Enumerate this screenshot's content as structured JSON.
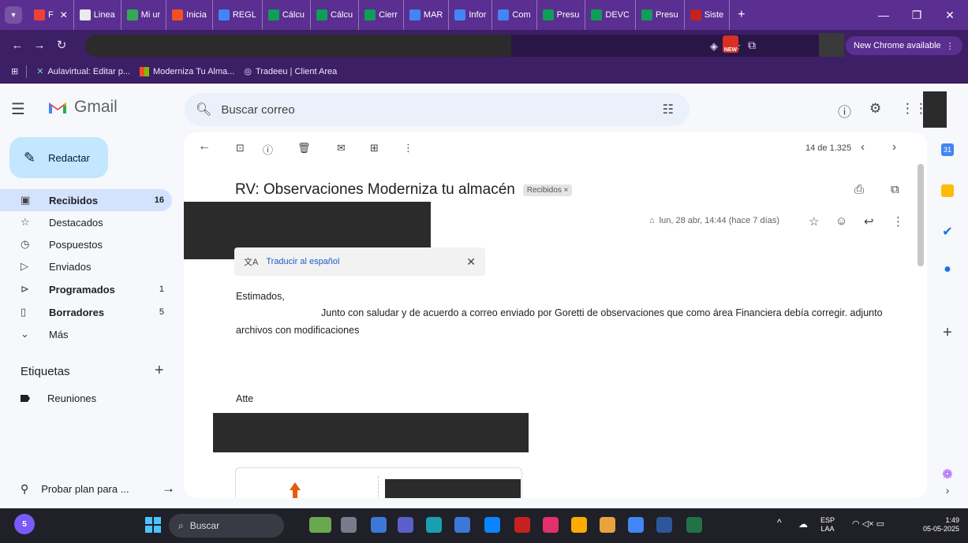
{
  "browser": {
    "tabs": [
      {
        "label": "F",
        "active": true
      },
      {
        "label": "Linea"
      },
      {
        "label": "Mi ur"
      },
      {
        "label": "Inicia"
      },
      {
        "label": "REGL"
      },
      {
        "label": "Cálcu"
      },
      {
        "label": "Cálcu"
      },
      {
        "label": "Cierr"
      },
      {
        "label": "MAR"
      },
      {
        "label": "Infor"
      },
      {
        "label": "Com"
      },
      {
        "label": "Presu"
      },
      {
        "label": "DEVC"
      },
      {
        "label": "Presu"
      },
      {
        "label": "Siste"
      }
    ],
    "update_label": "New Chrome available",
    "new_badge": "NEW",
    "bookmarks": [
      {
        "label": "Aulavirtual: Editar p..."
      },
      {
        "label": "Moderniza Tu Alma..."
      },
      {
        "label": "Tradeeu | Client Area"
      }
    ]
  },
  "gmail": {
    "logo_text": "Gmail",
    "search_placeholder": "Buscar correo",
    "compose_label": "Redactar",
    "nav": [
      {
        "label": "Recibidos",
        "count": "16",
        "icon": "inbox-icon",
        "active": true,
        "bold": true
      },
      {
        "label": "Destacados",
        "count": "",
        "icon": "star-icon"
      },
      {
        "label": "Pospuestos",
        "count": "",
        "icon": "clock-icon"
      },
      {
        "label": "Enviados",
        "count": "",
        "icon": "send-icon"
      },
      {
        "label": "Programados",
        "count": "1",
        "icon": "scheduled-icon",
        "bold": true
      },
      {
        "label": "Borradores",
        "count": "5",
        "icon": "draft-icon",
        "bold": true
      },
      {
        "label": "Más",
        "count": "",
        "icon": "chevron-down-icon"
      }
    ],
    "labels_title": "Etiquetas",
    "labels": [
      {
        "label": "Reuniones"
      }
    ],
    "promo_label": "Probar plan para ...",
    "pager": "14 de 1.325",
    "subject": "RV: Observaciones Moderniza tu almacén",
    "subject_chip": "Recibidos ×",
    "date": "lun, 28 abr, 14:44 (hace 7 días)",
    "translate_label": "Traducir al español",
    "body": {
      "greeting": "Estimados,",
      "line1": "Junto con saludar y de acuerdo a correo enviado por Goretti de observaciones que como área Financiera debía corregir. adjunto",
      "line2": "archivos con modificaciones",
      "signoff": "Atte"
    }
  },
  "taskbar": {
    "search_label": "Buscar",
    "notification_count": "5",
    "lang_line1": "ESP",
    "lang_line2": "LAA",
    "time": "1:49",
    "date": "05-05-2025"
  }
}
